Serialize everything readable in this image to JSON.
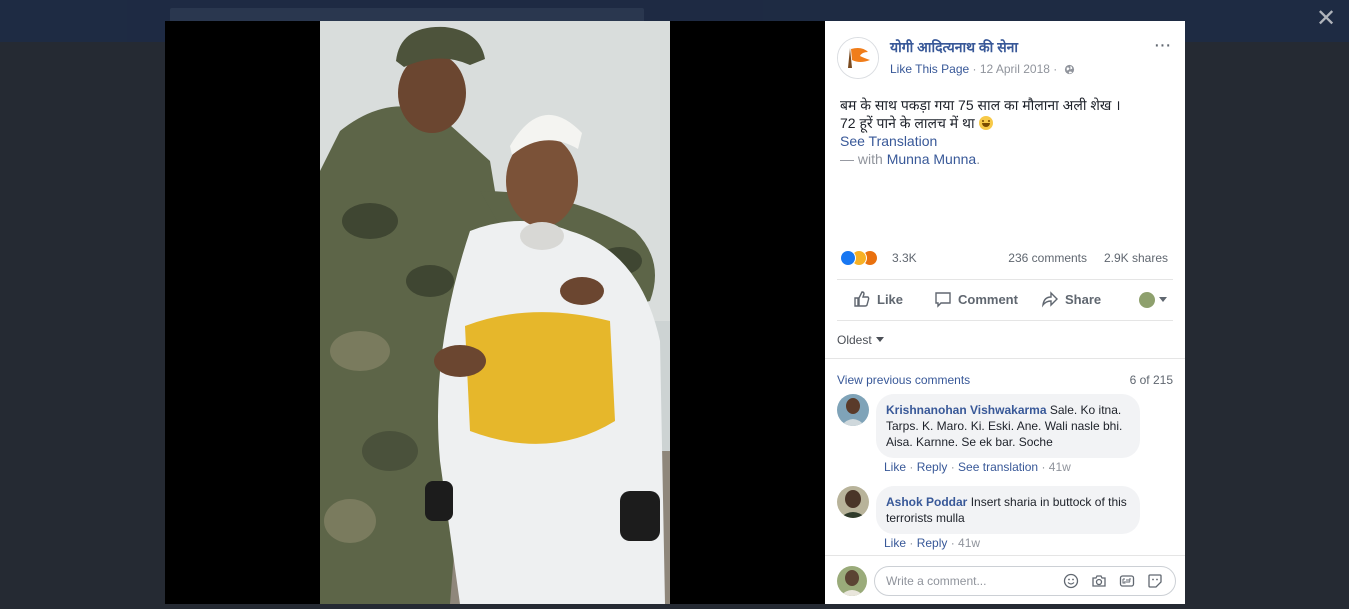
{
  "viewer": {
    "close_label": "✕"
  },
  "post": {
    "page_name": "योगी आदित्यनाथ की सेना",
    "like_page": "Like This Page",
    "date": "12 April 2018",
    "more": "···",
    "text_line1": "बम के साथ पकड़ा गया 75 साल का मौलाना अली शेख ।",
    "text_line2": "72 हूरें पाने के लालच में था",
    "see_translation": "See Translation",
    "with_prefix": "— with ",
    "with_name": "Munna Munna",
    "with_suffix": "."
  },
  "stats": {
    "reactions": "3.3K",
    "comments": "236 comments",
    "shares": "2.9K shares"
  },
  "actions": {
    "like": "Like",
    "comment": "Comment",
    "share": "Share"
  },
  "comments_section": {
    "sort_label": "Oldest",
    "view_previous": "View previous comments",
    "pager": "6 of 215",
    "items": [
      {
        "author": "Krishnanohan Vishwakarma",
        "text": "Sale. Ko itna. Tarps. K. Maro. Ki. Eski. Ane. Wali nasle bhi. Aisa. Karnne. Se ek bar. Soche",
        "like": "Like",
        "reply": "Reply",
        "translate": "See translation",
        "age": "41w"
      },
      {
        "author": "Ashok Poddar",
        "text": "Insert sharia in buttock of this terrorists mulla",
        "like": "Like",
        "reply": "Reply",
        "age": "41w"
      }
    ]
  },
  "composer": {
    "placeholder": "Write a comment..."
  },
  "colors": {
    "link": "#385898",
    "muted": "#90949c",
    "like_blue": "#1877f2",
    "backdrop": "#252a33"
  }
}
